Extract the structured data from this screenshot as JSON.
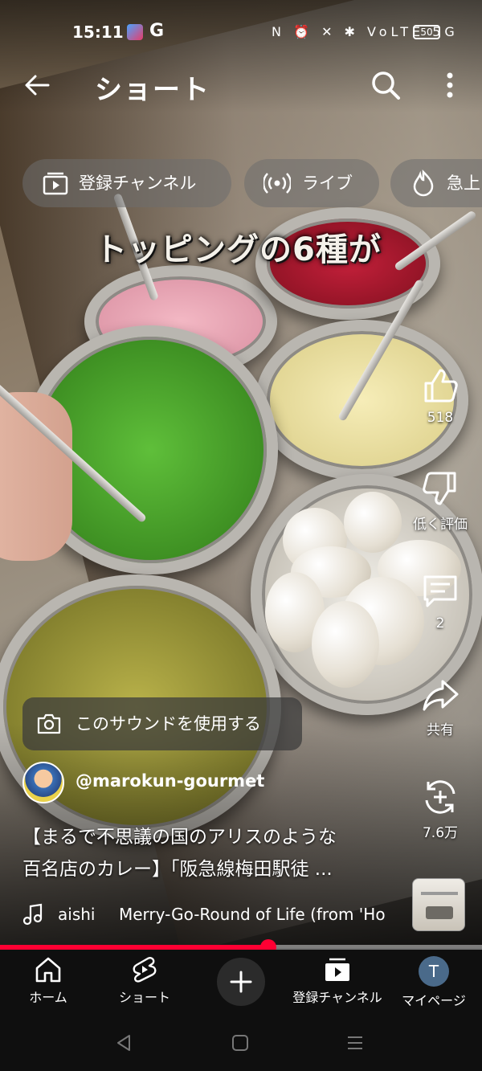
{
  "status_bar": {
    "time": "15:11",
    "app_letter": "G",
    "icons": "N ⏰ ✕ ✱ VoLTE 5G",
    "battery": "50"
  },
  "header": {
    "title": "ショート"
  },
  "chips": [
    {
      "label": "登録チャンネル",
      "icon": "subscriptions-icon"
    },
    {
      "label": "ライブ",
      "icon": "live-icon"
    },
    {
      "label": "急上",
      "icon": "trending-icon"
    }
  ],
  "video": {
    "caption": "トッピングの6種が"
  },
  "actions": {
    "like_count": "518",
    "dislike_label": "低く評価",
    "comment_count": "2",
    "share_label": "共有",
    "remix_count": "7.6万"
  },
  "sound_button": {
    "label": "このサウンドを使用する"
  },
  "channel": {
    "handle": "@marokun-gourmet"
  },
  "video_title": {
    "line1": "【まるで不思議の国のアリスのような",
    "line2": "百名店のカレー】「阪急線梅田駅徒 ..."
  },
  "music": {
    "artist": "aishi",
    "song": "Merry-Go-Round of Life (from 'Ho"
  },
  "progress": {
    "fraction": 0.557
  },
  "bottom_nav": {
    "home": "ホーム",
    "shorts": "ショート",
    "subscriptions": "登録チャンネル",
    "me": "マイページ",
    "avatar_letter": "T"
  },
  "colors": {
    "accent": "#ff0033",
    "nav_bg": "#0f0f0f"
  }
}
